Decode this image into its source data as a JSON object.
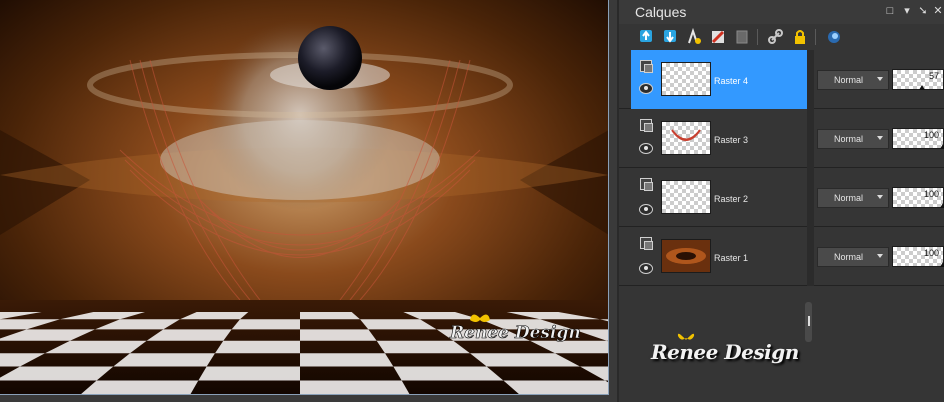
{
  "panel": {
    "title": "Calques",
    "header_icons": [
      "restore-icon",
      "dropdown-icon",
      "pin-icon",
      "close-icon"
    ]
  },
  "toolbar": {
    "icons": [
      "new-layer-icon",
      "merge-down-icon",
      "new-mask-icon",
      "delete-layer-icon",
      "group-icon",
      "link-icon",
      "lock-icon",
      "visibility-toggle-icon"
    ]
  },
  "layers": [
    {
      "name": "Raster 4",
      "blend": "Normal",
      "opacity": "57",
      "opacity_value": 57,
      "selected": true
    },
    {
      "name": "Raster 3",
      "blend": "Normal",
      "opacity": "100",
      "opacity_value": 100,
      "selected": false
    },
    {
      "name": "Raster 2",
      "blend": "Normal",
      "opacity": "100",
      "opacity_value": 100,
      "selected": false
    },
    {
      "name": "Raster 1",
      "blend": "Normal",
      "opacity": "100",
      "opacity_value": 100,
      "selected": false
    }
  ],
  "watermark": {
    "canvas_text": "Renee Design",
    "panel_text": "Renee Design"
  },
  "colors": {
    "accent": "#3399ff",
    "panel_bg": "#353535",
    "butterfly": "#f2c200"
  }
}
